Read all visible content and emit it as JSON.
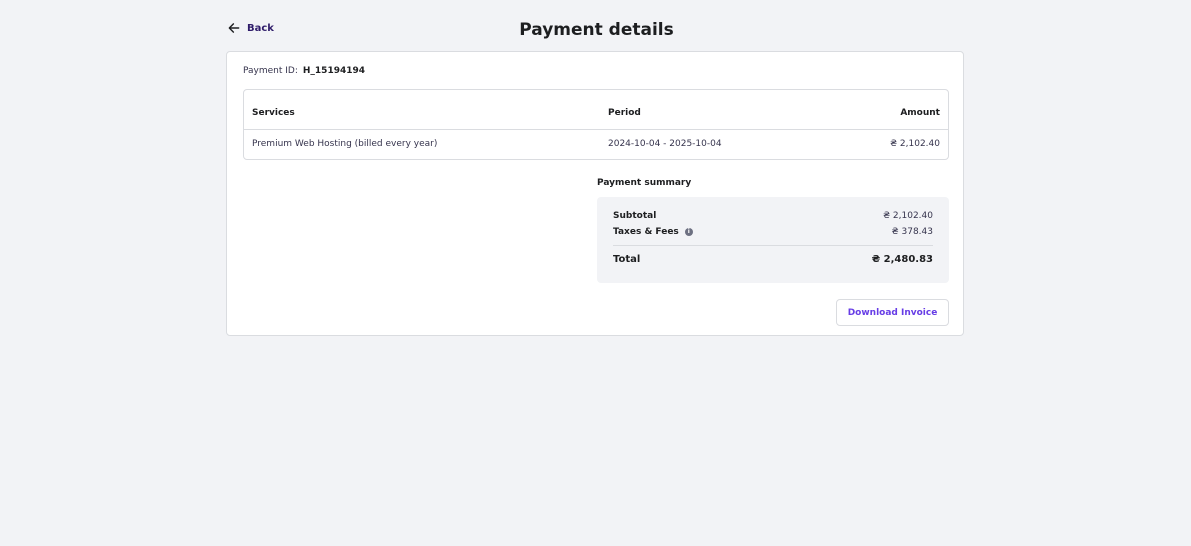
{
  "header": {
    "back_label": "Back",
    "title": "Payment details"
  },
  "payment": {
    "id_label": "Payment ID:",
    "id_value": "H_15194194"
  },
  "services_table": {
    "columns": [
      "Services",
      "Period",
      "Amount"
    ],
    "rows": [
      {
        "service": "Premium Web Hosting (billed every year)",
        "period": "2024-10-04 - 2025-10-04",
        "amount": "₴ 2,102.40"
      }
    ]
  },
  "summary": {
    "heading": "Payment summary",
    "subtotal_label": "Subtotal",
    "subtotal_value": "₴ 2,102.40",
    "taxes_label": "Taxes & Fees",
    "taxes_value": "₴ 378.43",
    "total_label": "Total",
    "total_value": "₴ 2,480.83"
  },
  "actions": {
    "download_label": "Download Invoice"
  },
  "colors": {
    "background": "#f2f3f6",
    "accent": "#673de6",
    "text": "#1d1e20"
  },
  "icons": {
    "back": "arrow-left-icon",
    "taxes_info": "info-icon"
  }
}
